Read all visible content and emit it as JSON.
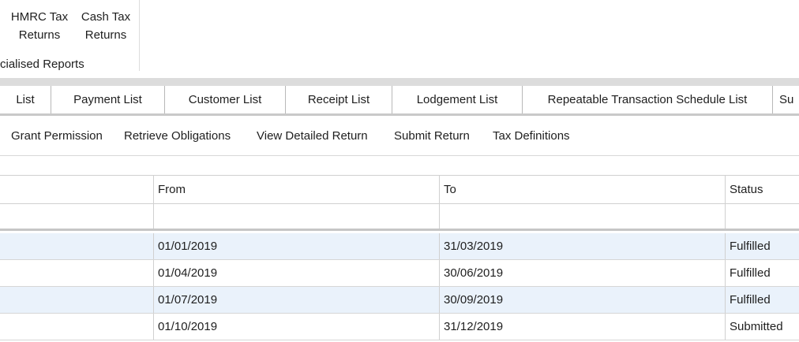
{
  "ribbon": {
    "buttons": [
      {
        "line1": "HMRC Tax",
        "line2": "Returns"
      },
      {
        "line1": "Cash Tax",
        "line2": "Returns"
      }
    ],
    "group_label": "cialised Reports"
  },
  "tabs": [
    "List",
    "Payment List",
    "Customer List",
    "Receipt List",
    "Lodgement List",
    "Repeatable Transaction Schedule List",
    "Su"
  ],
  "toolbar": [
    "Grant Permission",
    "Retrieve Obligations",
    "View Detailed Return",
    "Submit Return",
    "Tax Definitions"
  ],
  "grid": {
    "columns": [
      "",
      "From",
      "To",
      "Status"
    ],
    "rows": [
      {
        "from": "01/01/2019",
        "to": "31/03/2019",
        "status": "Fulfilled"
      },
      {
        "from": "01/04/2019",
        "to": "30/06/2019",
        "status": "Fulfilled"
      },
      {
        "from": "01/07/2019",
        "to": "30/09/2019",
        "status": "Fulfilled"
      },
      {
        "from": "01/10/2019",
        "to": "31/12/2019",
        "status": "Submitted"
      }
    ]
  },
  "colors": {
    "alt_row": "#eaf2fb",
    "divider": "#d0d0d0",
    "tabstrip": "#dcdcdc"
  }
}
